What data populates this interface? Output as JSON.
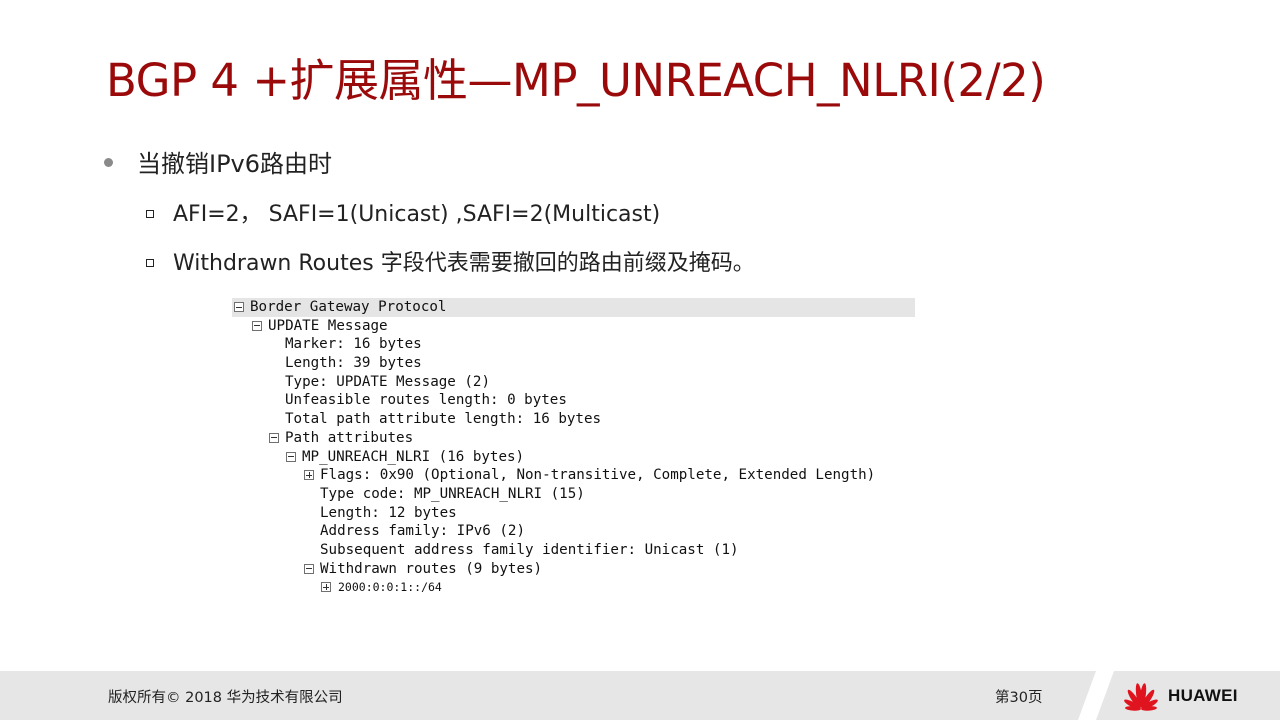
{
  "title": "BGP 4 +扩展属性—MP_UNREACH_NLRI(2/2)",
  "bullets": {
    "main": "当撤销IPv6路由时",
    "sub": [
      "AFI=2， SAFI=1(Unicast) ,SAFI=2(Multicast)",
      "Withdrawn Routes 字段代表需要撤回的路由前缀及掩码。"
    ]
  },
  "packet_tree": [
    {
      "label": "Border Gateway Protocol",
      "toggle": "collapse"
    },
    {
      "label": "UPDATE Message",
      "toggle": "collapse"
    },
    {
      "label": "Marker: 16 bytes"
    },
    {
      "label": "Length: 39 bytes"
    },
    {
      "label": "Type: UPDATE Message (2)"
    },
    {
      "label": "Unfeasible routes length: 0 bytes"
    },
    {
      "label": "Total path attribute length: 16 bytes"
    },
    {
      "label": "Path attributes",
      "toggle": "collapse"
    },
    {
      "label": "MP_UNREACH_NLRI (16 bytes)",
      "toggle": "collapse"
    },
    {
      "label": "Flags: 0x90 (Optional, Non-transitive, Complete, Extended Length)",
      "toggle": "expand"
    },
    {
      "label": "Type code: MP_UNREACH_NLRI (15)"
    },
    {
      "label": "Length: 12 bytes"
    },
    {
      "label": "Address family: IPv6 (2)"
    },
    {
      "label": "Subsequent address family identifier: Unicast (1)"
    },
    {
      "label": "Withdrawn routes (9 bytes)",
      "toggle": "collapse"
    },
    {
      "label": "2000:0:0:1::/64",
      "toggle": "expand"
    }
  ],
  "footer": {
    "copyright": "版权所有© 2018 华为技术有限公司",
    "page": "第30页",
    "brand": "HUAWEI"
  },
  "colors": {
    "title": "#9b0a0a",
    "logo_red": "#e0141e",
    "footer_bg": "#e6e6e6"
  }
}
